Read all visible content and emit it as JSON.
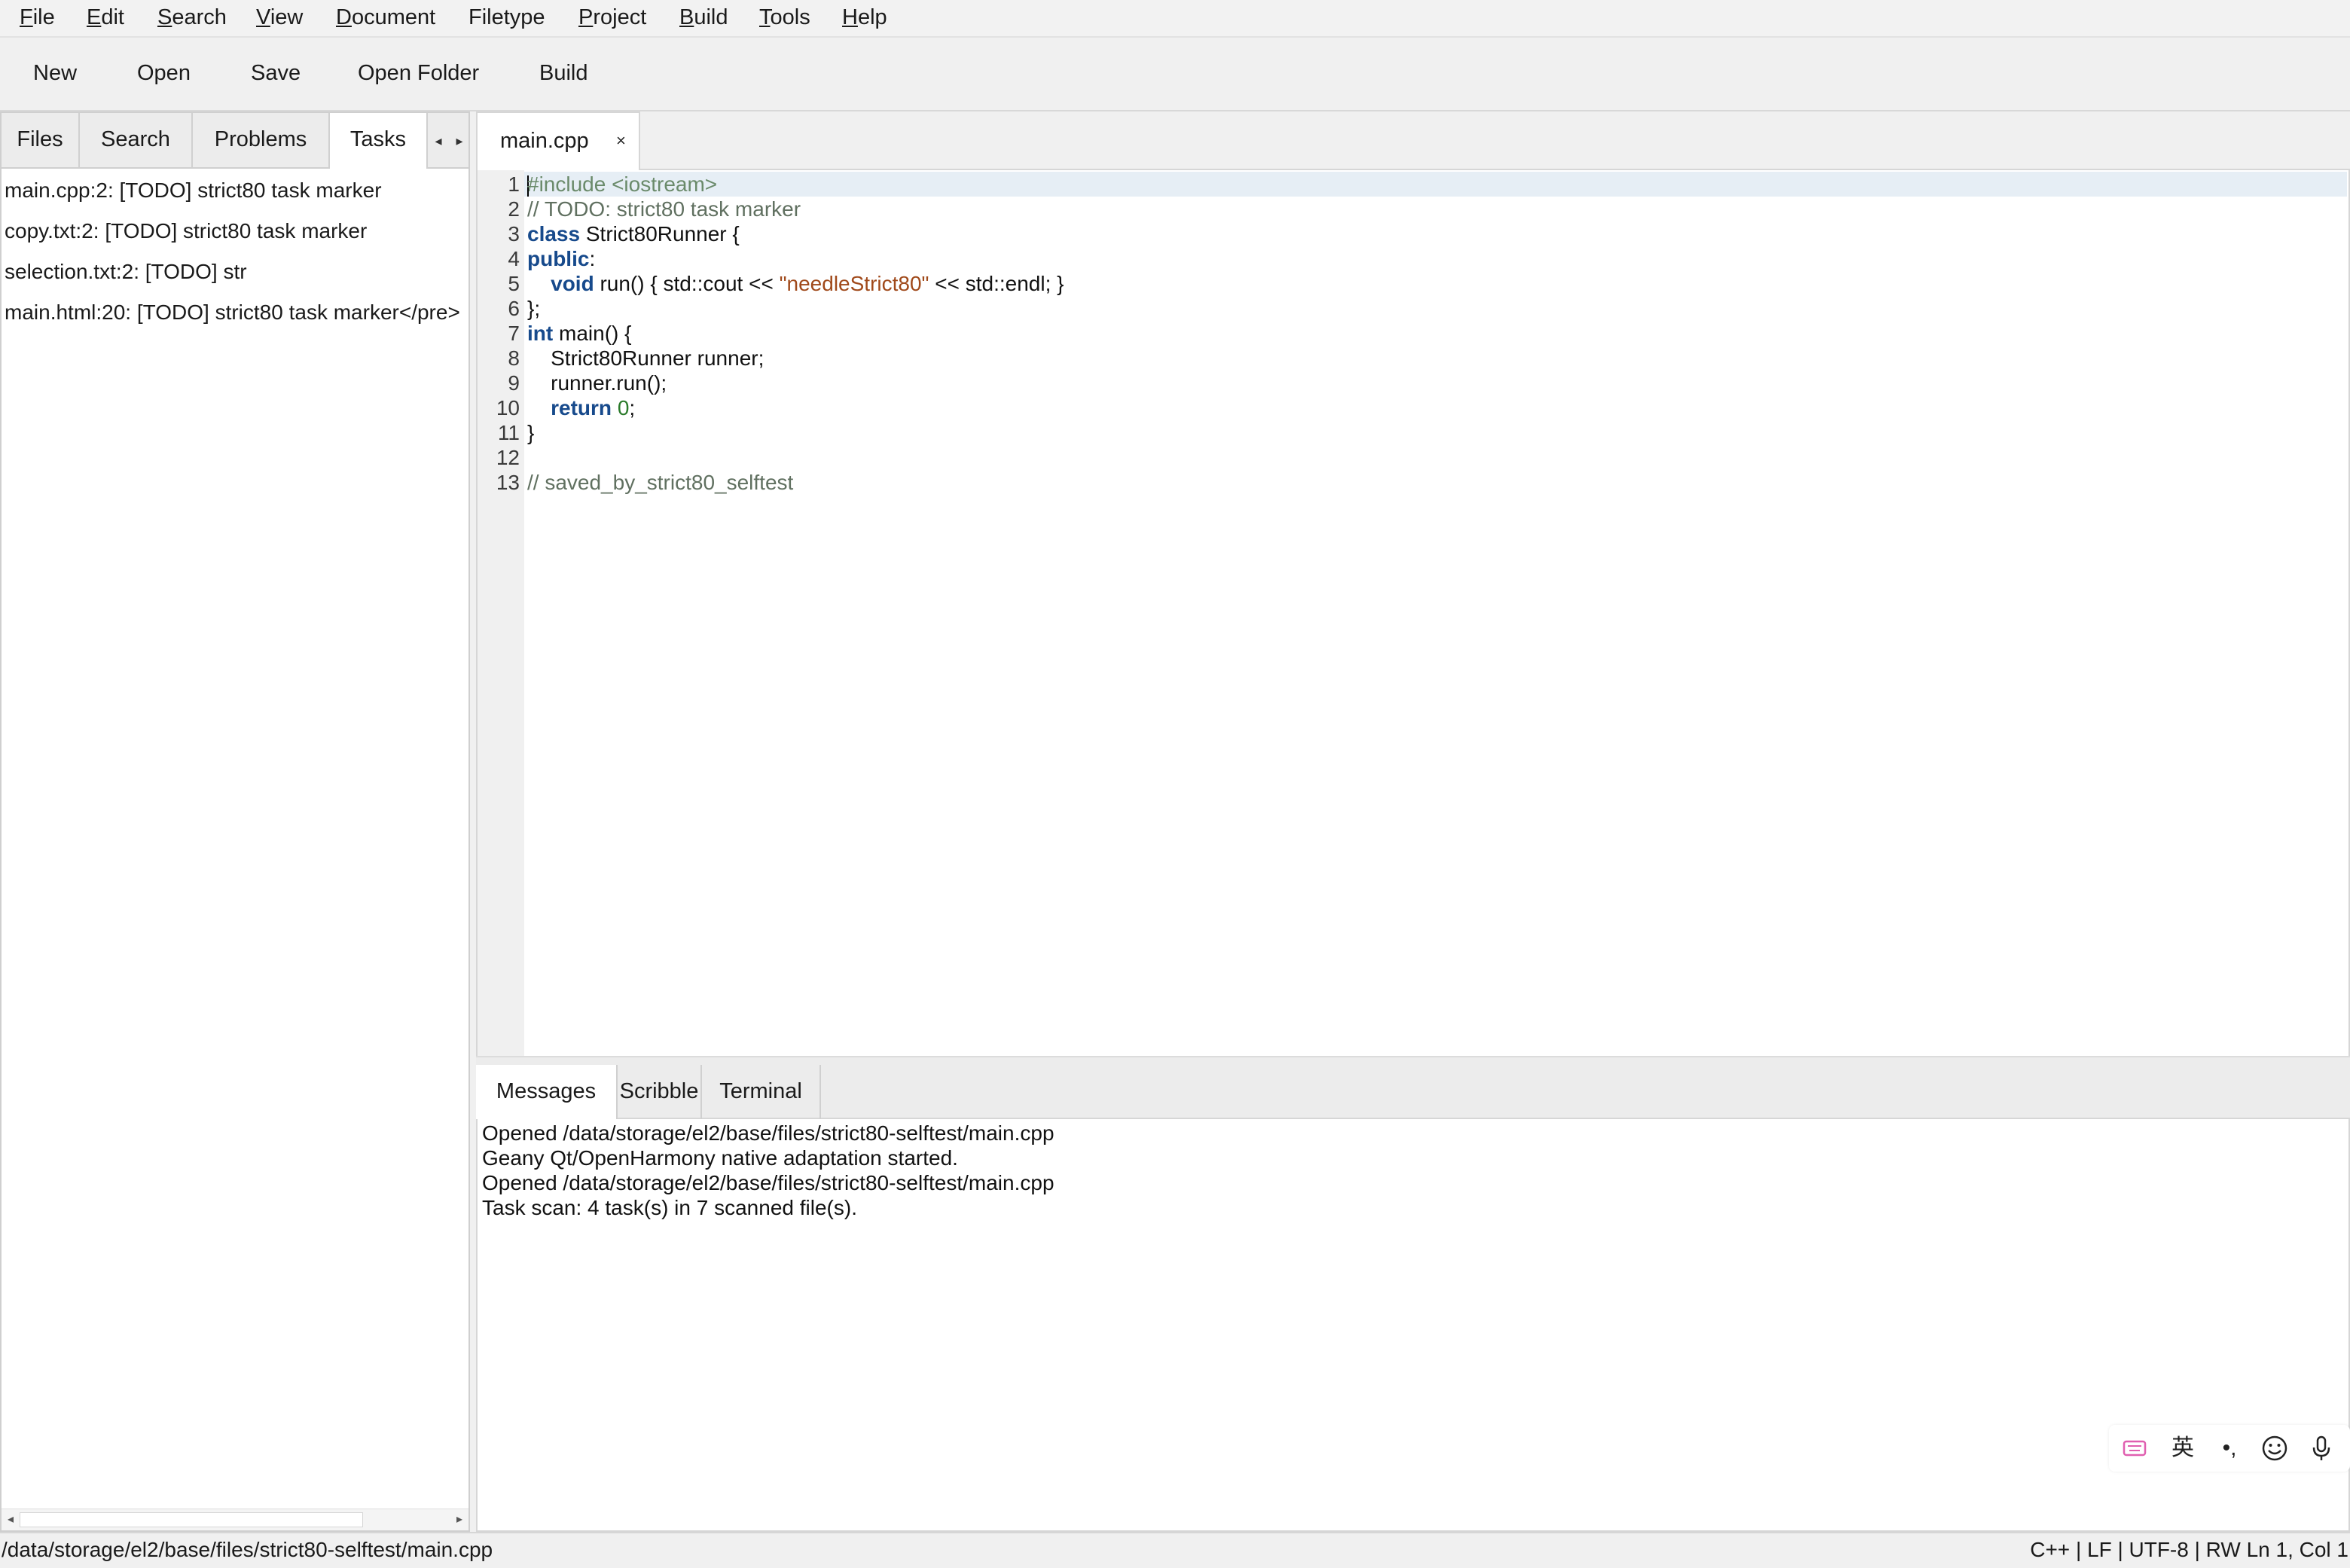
{
  "menubar": {
    "items": [
      {
        "mnemonic": "F",
        "rest": "ile"
      },
      {
        "mnemonic": "E",
        "rest": "dit"
      },
      {
        "mnemonic": "S",
        "rest": "earch"
      },
      {
        "mnemonic": "V",
        "rest": "iew"
      },
      {
        "mnemonic": "D",
        "rest": "ocument"
      },
      {
        "mnemonic": "",
        "rest": "Filetype"
      },
      {
        "mnemonic": "P",
        "rest": "roject"
      },
      {
        "mnemonic": "B",
        "rest": "uild"
      },
      {
        "mnemonic": "T",
        "rest": "ools"
      },
      {
        "mnemonic": "H",
        "rest": "elp"
      }
    ]
  },
  "toolbar": {
    "new_label": "New",
    "open_label": "Open",
    "save_label": "Save",
    "open_folder_label": "Open Folder",
    "build_label": "Build"
  },
  "sidebar": {
    "tabs": [
      "Files",
      "Search",
      "Problems",
      "Tasks"
    ],
    "active_tab": "Tasks",
    "tasks": [
      "main.cpp:2: [TODO] strict80 task marker",
      "copy.txt:2: [TODO] strict80 task marker",
      "selection.txt:2: [TODO] str",
      "main.html:20: [TODO] strict80 task marker</pre>"
    ]
  },
  "editor": {
    "tab_label": "main.cpp",
    "close_glyph": "×",
    "lines": [
      {
        "n": "1",
        "parts": [
          {
            "t": "#include <iostream>",
            "c": "pre"
          }
        ]
      },
      {
        "n": "2",
        "parts": [
          {
            "t": "// TODO: strict80 task marker",
            "c": "cmt"
          }
        ]
      },
      {
        "n": "3",
        "parts": [
          {
            "t": "class",
            "c": "kw"
          },
          {
            "t": " Strict80Runner {",
            "c": ""
          }
        ]
      },
      {
        "n": "4",
        "parts": [
          {
            "t": "public",
            "c": "kw"
          },
          {
            "t": ":",
            "c": ""
          }
        ]
      },
      {
        "n": "5",
        "parts": [
          {
            "t": "    ",
            "c": ""
          },
          {
            "t": "void",
            "c": "kw"
          },
          {
            "t": " run() { std::cout << ",
            "c": ""
          },
          {
            "t": "\"needleStrict80\"",
            "c": "str"
          },
          {
            "t": " << std::endl; }",
            "c": ""
          }
        ]
      },
      {
        "n": "6",
        "parts": [
          {
            "t": "};",
            "c": ""
          }
        ]
      },
      {
        "n": "7",
        "parts": [
          {
            "t": "int",
            "c": "kw"
          },
          {
            "t": " main() {",
            "c": ""
          }
        ]
      },
      {
        "n": "8",
        "parts": [
          {
            "t": "    Strict80Runner runner;",
            "c": ""
          }
        ]
      },
      {
        "n": "9",
        "parts": [
          {
            "t": "    runner.run();",
            "c": ""
          }
        ]
      },
      {
        "n": "10",
        "parts": [
          {
            "t": "    ",
            "c": ""
          },
          {
            "t": "return",
            "c": "kw"
          },
          {
            "t": " ",
            "c": ""
          },
          {
            "t": "0",
            "c": "num"
          },
          {
            "t": ";",
            "c": ""
          }
        ]
      },
      {
        "n": "11",
        "parts": [
          {
            "t": "}",
            "c": ""
          }
        ]
      },
      {
        "n": "12",
        "parts": []
      },
      {
        "n": "13",
        "parts": [
          {
            "t": "// saved_by_strict80_selftest",
            "c": "cmt"
          }
        ]
      }
    ]
  },
  "messages": {
    "tabs": [
      "Messages",
      "Scribble",
      "Terminal"
    ],
    "active_tab": "Messages",
    "lines": [
      "Opened /data/storage/el2/base/files/strict80-selftest/main.cpp",
      "Geany Qt/OpenHarmony native adaptation started.",
      "Opened /data/storage/el2/base/files/strict80-selftest/main.cpp",
      "Task scan: 4 task(s) in 7 scanned file(s)."
    ]
  },
  "ime": {
    "lang_label": "英",
    "punct_label": "•,",
    "icons": [
      "keyboard-icon",
      "emoji-icon",
      "microphone-icon"
    ]
  },
  "statusbar": {
    "path": "/data/storage/el2/base/files/strict80-selftest/main.cpp",
    "info": "C++ | LF | UTF-8 | RW Ln 1, Col 1"
  }
}
